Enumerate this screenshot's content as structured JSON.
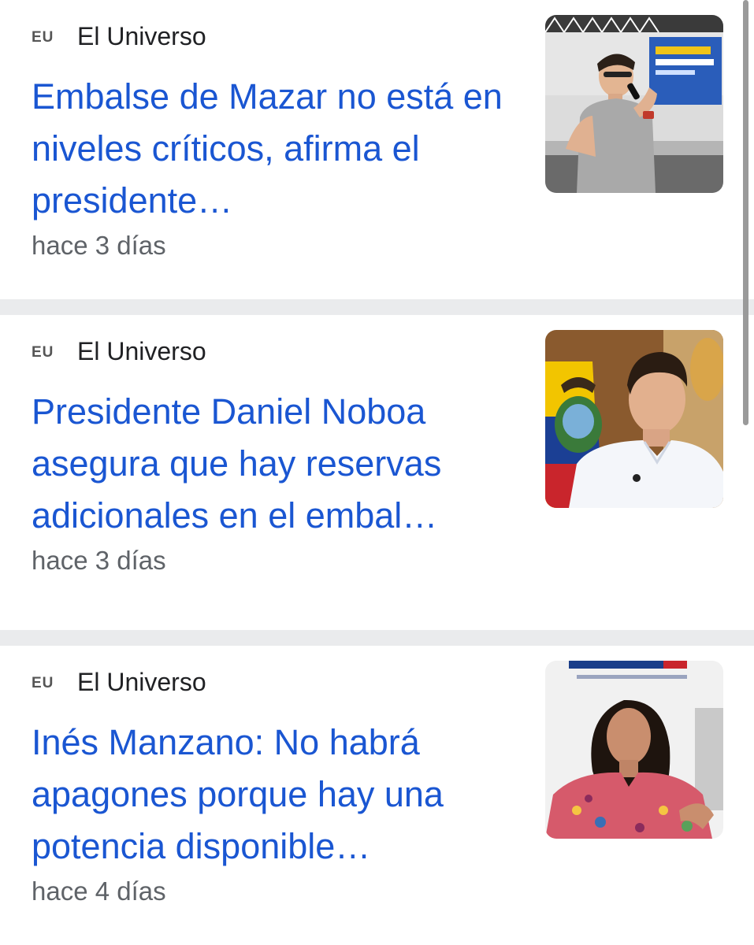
{
  "articles": [
    {
      "source_logo": "EU",
      "source_name": "El Universo",
      "headline": "Embalse de Mazar no está en niveles críticos, afirma el presidente…",
      "time": "hace 3 días",
      "thumbnail": "photo-man-speaking-microphone"
    },
    {
      "source_logo": "EU",
      "source_name": "El Universo",
      "headline": "Presidente Daniel Noboa asegura que hay reservas adicionales en el embal…",
      "time": "hace 3 días",
      "thumbnail": "photo-man-with-ecuador-flag"
    },
    {
      "source_logo": "EU",
      "source_name": "El Universo",
      "headline": "Inés Manzano: No habrá apagones porque hay una potencia disponible…",
      "time": "hace 4 días",
      "thumbnail": "photo-woman-speaking"
    }
  ],
  "colors": {
    "headline": "#1a56d2",
    "divider": "#eaebed",
    "meta": "#5f6368"
  }
}
